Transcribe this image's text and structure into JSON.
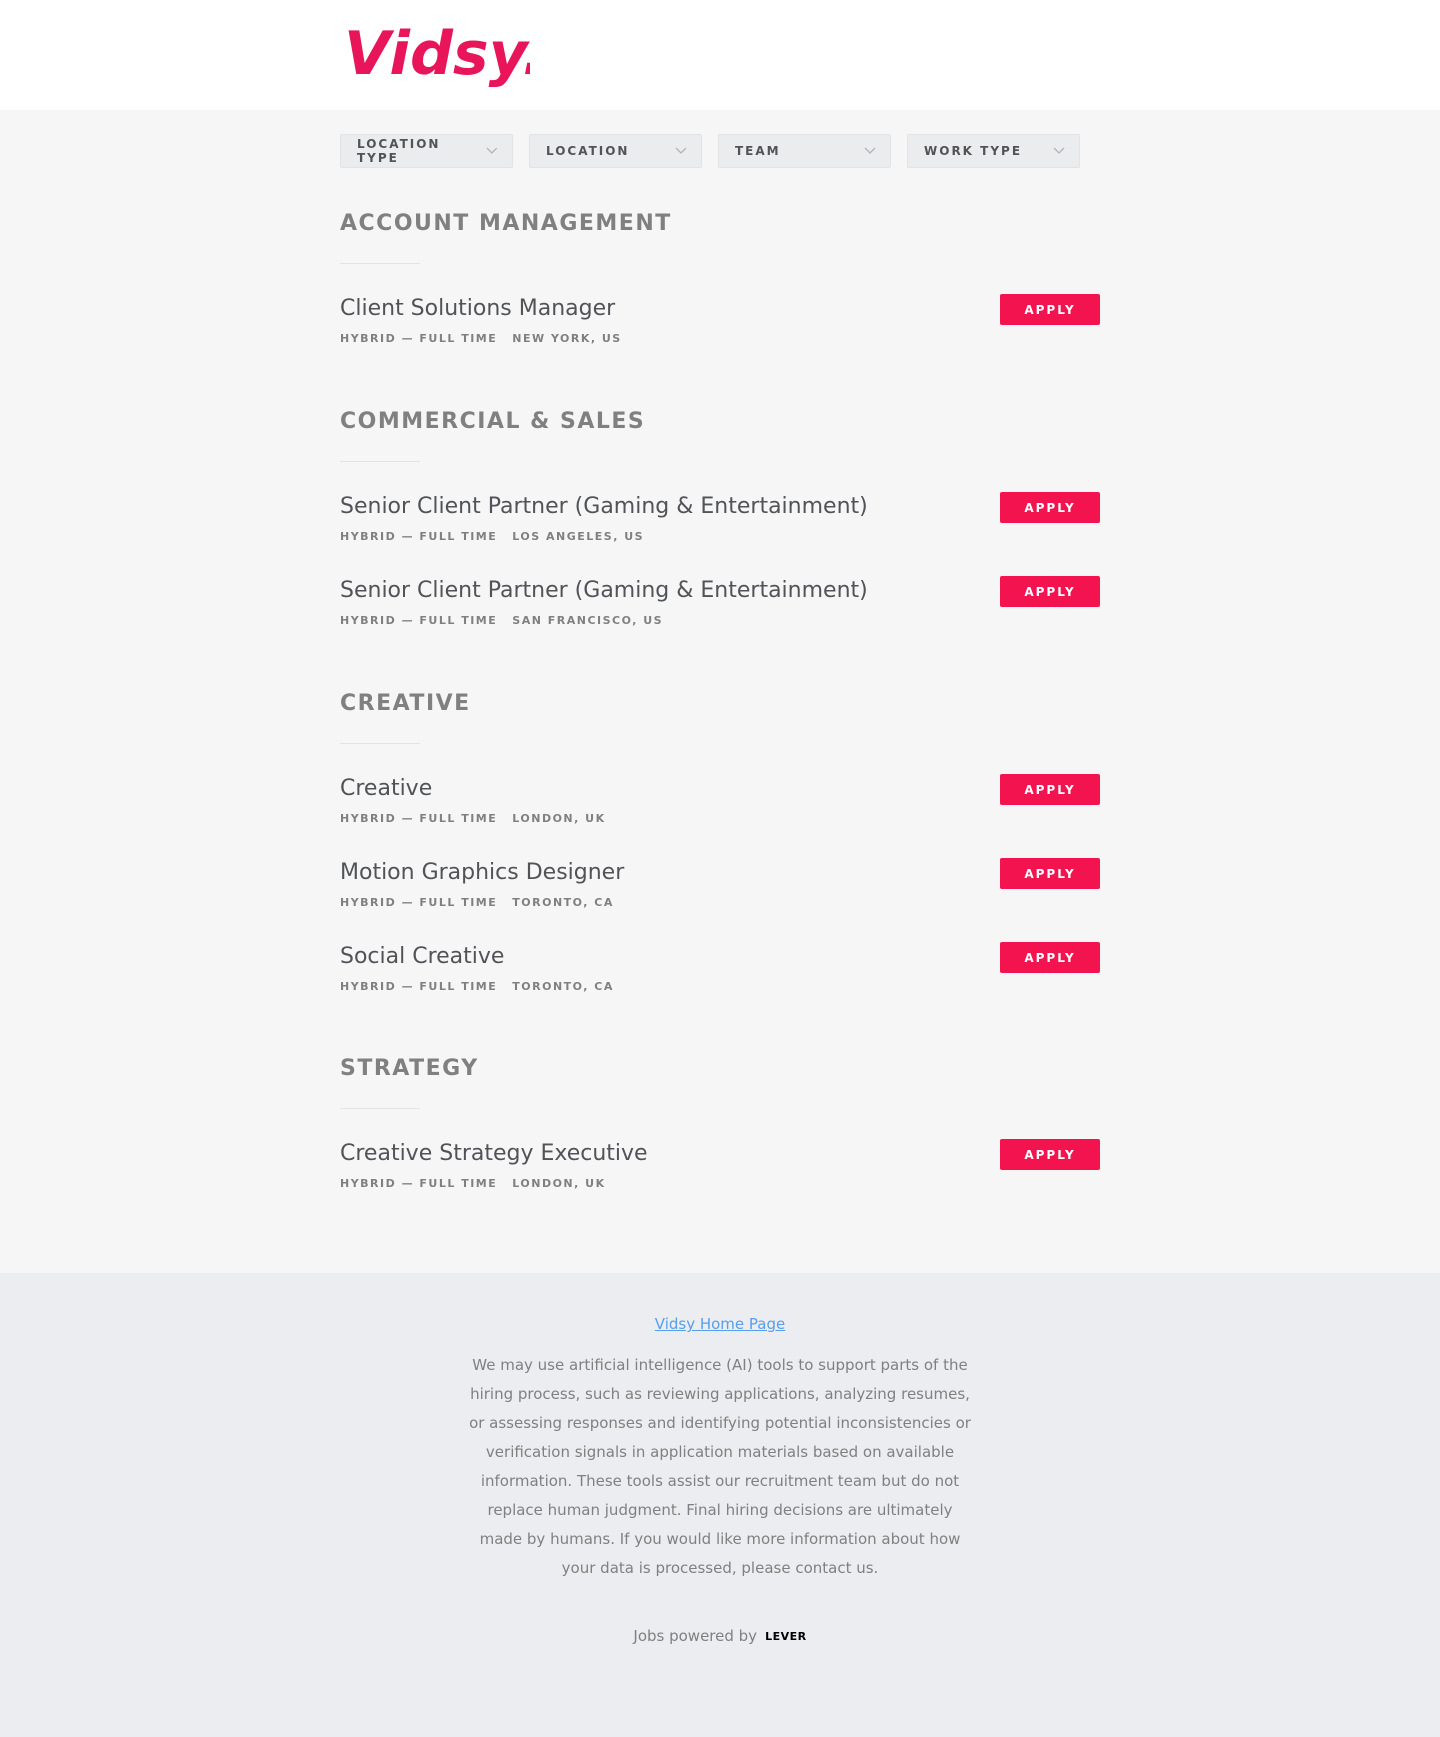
{
  "brand": {
    "name": "Vidsy.",
    "color": "#e8155a"
  },
  "filters": [
    {
      "label": "LOCATION TYPE",
      "icon": "chevron-down-icon"
    },
    {
      "label": "LOCATION",
      "icon": "chevron-down-icon"
    },
    {
      "label": "TEAM",
      "icon": "chevron-down-icon"
    },
    {
      "label": "WORK TYPE",
      "icon": "chevron-down-icon"
    }
  ],
  "apply_label": "APPLY",
  "sections": [
    {
      "title": "ACCOUNT MANAGEMENT",
      "postings": [
        {
          "title": "Client Solutions Manager",
          "commitment": "HYBRID — FULL TIME",
          "location": "NEW YORK, US"
        }
      ]
    },
    {
      "title": "COMMERCIAL & SALES",
      "postings": [
        {
          "title": "Senior Client Partner (Gaming & Entertainment)",
          "commitment": "HYBRID — FULL TIME",
          "location": "LOS ANGELES, US"
        },
        {
          "title": "Senior Client Partner (Gaming & Entertainment)",
          "commitment": "HYBRID — FULL TIME",
          "location": "SAN FRANCISCO, US"
        }
      ]
    },
    {
      "title": "CREATIVE",
      "postings": [
        {
          "title": "Creative",
          "commitment": "HYBRID — FULL TIME",
          "location": "LONDON, UK"
        },
        {
          "title": "Motion Graphics Designer",
          "commitment": "HYBRID — FULL TIME",
          "location": "TORONTO, CA"
        },
        {
          "title": "Social Creative",
          "commitment": "HYBRID — FULL TIME",
          "location": "TORONTO, CA"
        }
      ]
    },
    {
      "title": "STRATEGY",
      "postings": [
        {
          "title": "Creative Strategy Executive",
          "commitment": "HYBRID — FULL TIME",
          "location": "LONDON, UK"
        }
      ]
    }
  ],
  "footer": {
    "home_link": "Vidsy Home Page",
    "ai_notice": "We may use artificial intelligence (AI) tools to support parts of the hiring process, such as reviewing applications, analyzing resumes, or assessing responses and identifying potential inconsistencies or verification signals in application materials based on available information. These tools assist our recruitment team but do not replace human judgment. Final hiring decisions are ultimately made by humans. If you would like more information about how your data is processed, please contact us.",
    "powered_by": "Jobs powered by",
    "lever": "LEVER"
  },
  "colors": {
    "accent": "#f2134f",
    "link": "#579eee"
  }
}
